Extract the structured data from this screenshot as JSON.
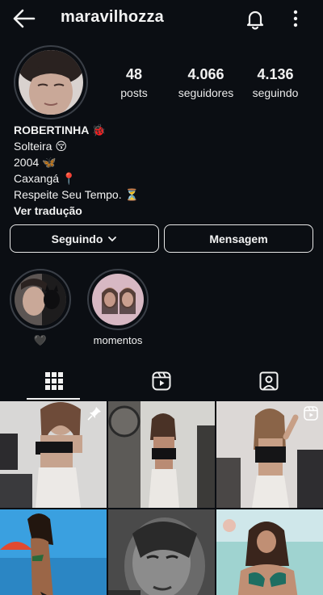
{
  "header": {
    "username": "maravilhozza"
  },
  "stats": [
    {
      "value": "48",
      "label": "posts"
    },
    {
      "value": "4.066",
      "label": "seguidores"
    },
    {
      "value": "4.136",
      "label": "seguindo"
    }
  ],
  "bio": {
    "name": "ROBERTINHA 🐞",
    "lines": [
      "Solteira 😚",
      "2004 🦋",
      "Caxangá 📍",
      "Respeite Seu Tempo. ⏳"
    ],
    "translate": "Ver tradução"
  },
  "buttons": {
    "following": "Seguindo",
    "message": "Mensagem"
  },
  "highlights": [
    {
      "label": "🖤"
    },
    {
      "label": "momentos"
    }
  ],
  "tabs": [
    {
      "icon": "grid-icon",
      "active": true
    },
    {
      "icon": "reels-icon",
      "active": false
    },
    {
      "icon": "tagged-icon",
      "active": false
    }
  ],
  "grid_badges": {
    "post_1": "pin-icon",
    "post_3": "reels-icon"
  },
  "colors": {
    "background": "#0b0e13",
    "text": "#f2f2f2",
    "ring": "#3a3f47"
  }
}
